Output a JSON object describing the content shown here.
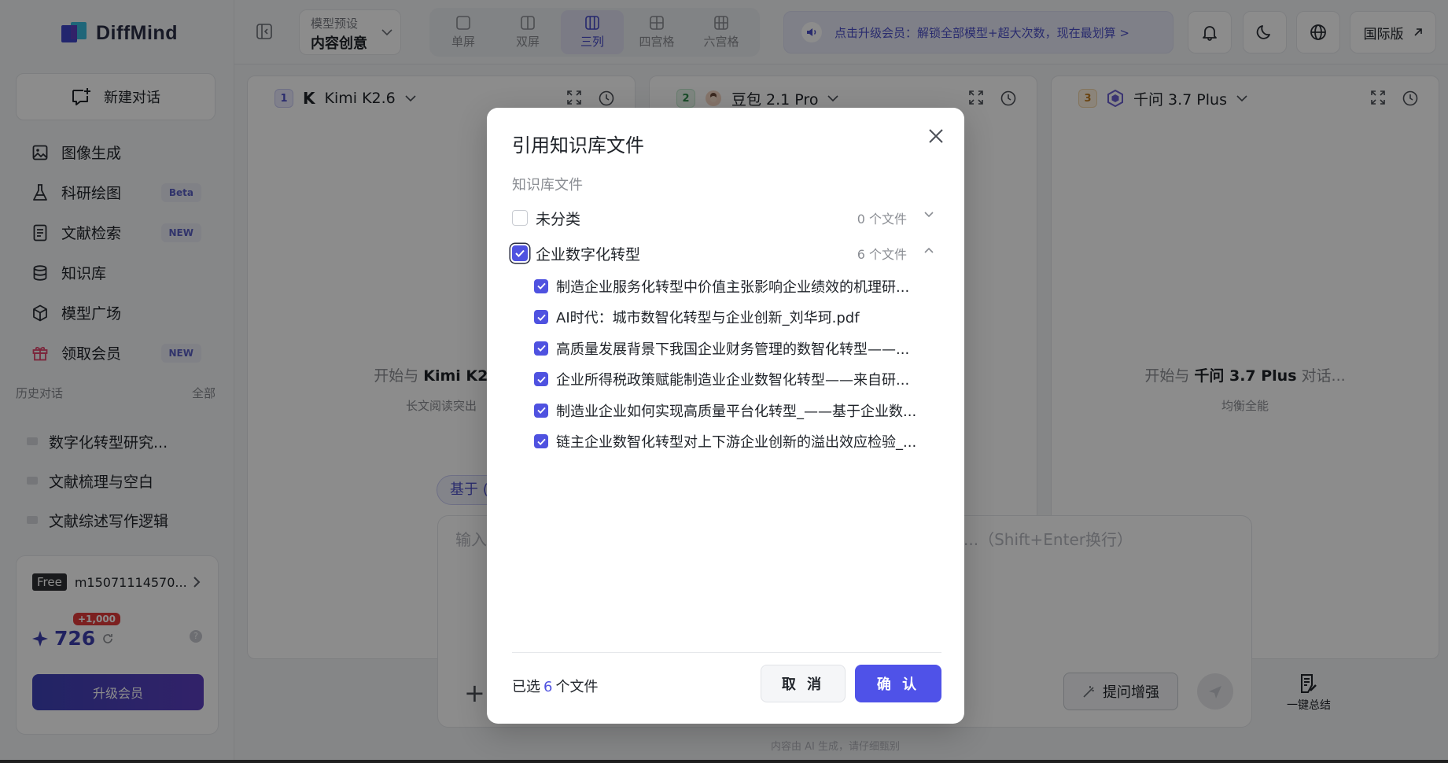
{
  "app": {
    "name": "DiffMind",
    "new_chat": "新建对话",
    "colors": {
      "accent": "#4f52e8",
      "accent_dark": "#3e42b8",
      "badge_red": "#e23b3b"
    }
  },
  "sidebar": {
    "items": [
      {
        "label": "图像生成",
        "icon": "image-icon",
        "badge": ""
      },
      {
        "label": "科研绘图",
        "icon": "flask-icon",
        "badge": "Beta"
      },
      {
        "label": "文献检索",
        "icon": "document-icon",
        "badge": "NEW"
      },
      {
        "label": "知识库",
        "icon": "database-icon",
        "badge": ""
      },
      {
        "label": "模型广场",
        "icon": "cube-icon",
        "badge": ""
      },
      {
        "label": "领取会员",
        "icon": "gift-icon",
        "badge": "NEW"
      }
    ],
    "history_label": "历史对话",
    "history_all": "全部",
    "history": [
      "数字化转型研究...",
      "文献梳理与空白",
      "文献综述写作逻辑"
    ]
  },
  "user": {
    "plan": "Free",
    "account": "m15071114570...",
    "bonus": "+1,000",
    "points": "726",
    "upgrade": "升级会员"
  },
  "topbar": {
    "preset_label": "模型预设",
    "preset_value": "内容创意",
    "layouts": [
      "单屏",
      "双屏",
      "三列",
      "四宫格",
      "六宫格"
    ],
    "active_layout": "三列",
    "notice": "点击升级会员：解锁全部模型+超大次数，现在最划算 >",
    "intl": "国际版"
  },
  "panels": [
    {
      "index": "1",
      "model": "Kimi K2.6",
      "prefix": "开始与",
      "suffix": "",
      "sub": "长文阅读突出"
    },
    {
      "index": "2",
      "model": "豆包 2.1 Pro",
      "prefix": "",
      "suffix": "",
      "sub": ""
    },
    {
      "index": "3",
      "model": "千问 3.7 Plus",
      "prefix": "开始与",
      "suffix": "对话...",
      "sub": "均衡全能"
    }
  ],
  "composer": {
    "chip": "基于 (",
    "placeholder_left": "输入",
    "placeholder_right": "...（Shift+Enter换行）",
    "plus": "+",
    "enhance": "提问增强",
    "summarize": "一键总结",
    "disclaimer": "内容由 AI 生成，请仔细甄别"
  },
  "modal": {
    "title": "引用知识库文件",
    "subtitle": "知识库文件",
    "categories": [
      {
        "name": "未分类",
        "count": "0 个文件",
        "checked": false,
        "expanded": false
      },
      {
        "name": "企业数字化转型",
        "count": "6 个文件",
        "checked": true,
        "expanded": true
      }
    ],
    "files": [
      "制造企业服务化转型中价值主张影响企业绩效的机理研...",
      "AI时代：城市数智化转型与企业创新_刘华珂.pdf",
      "高质量发展背景下我国企业财务管理的数智化转型——...",
      "企业所得税政策赋能制造业企业数智化转型——来自研...",
      "制造业企业如何实现高质量平台化转型_——基于企业数...",
      "链主企业数智化转型对上下游企业创新的溢出效应检验_..."
    ],
    "selected_prefix": "已选",
    "selected_count": "6",
    "selected_suffix": "个文件",
    "cancel": "取 消",
    "confirm": "确 认"
  }
}
